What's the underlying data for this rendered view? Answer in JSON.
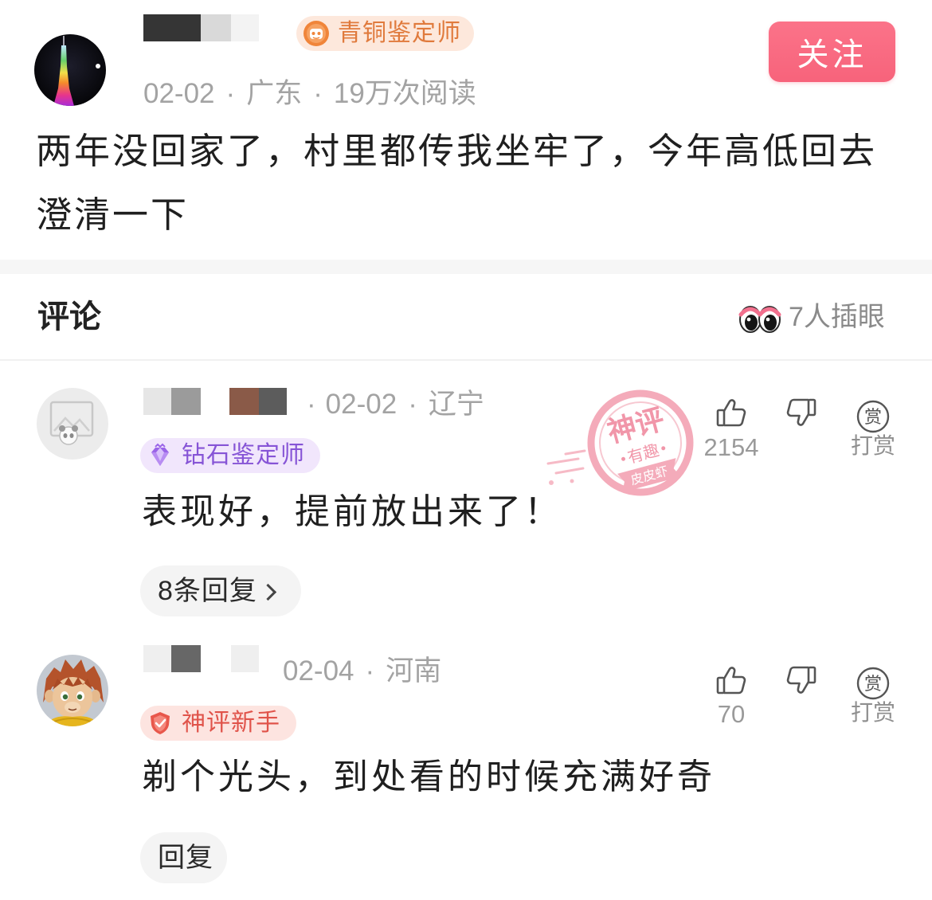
{
  "post": {
    "author": {
      "avatar_icon": "tower-night-avatar",
      "badge": {
        "label": "青铜鉴定师",
        "icon": "bronze-appraiser-icon",
        "color": "#e07a3c",
        "bg": "#fde8dc"
      }
    },
    "follow_label": "关注",
    "meta": {
      "date": "02-02",
      "separator": "·",
      "location": "广东",
      "reads": "19万次阅读"
    },
    "text_lines": [
      "两年没回家了，村里都传我坐牢了，今年高低回去",
      "澄清一下"
    ]
  },
  "comments_section": {
    "title": "评论",
    "watchers_icon": "eyes-icon",
    "watchers_label": "7人插眼"
  },
  "comments": [
    {
      "avatar_icon": "default-avatar",
      "meta": {
        "lead_separator": "·",
        "date": "02-02",
        "separator": "·",
        "location": "辽宁"
      },
      "badge": {
        "label": "钻石鉴定师",
        "icon": "diamond-appraiser-icon",
        "color": "#8654d6",
        "bg": "#f1e6fc"
      },
      "text": "表现好，提前放出来了！",
      "likes": "2154",
      "reward_icon_text": "赏",
      "reward_label": "打赏",
      "reply_label": "8条回复",
      "stamp": {
        "top": "神评",
        "middle": "有趣",
        "bottom": "皮皮虾"
      }
    },
    {
      "avatar_icon": "monkey-cartoon-avatar",
      "meta": {
        "date": "02-04",
        "separator": "·",
        "location": "河南"
      },
      "badge": {
        "label": "神评新手",
        "icon": "god-comment-novice-icon",
        "color": "#e0534a",
        "bg": "#fde4e0"
      },
      "text": "剃个光头，到处看的时候充满好奇",
      "likes": "70",
      "reward_icon_text": "赏",
      "reward_label": "打赏",
      "reply_label": "回复"
    }
  ],
  "colors": {
    "follow_bg": "#f86b80",
    "text": "#222222",
    "meta": "#a3a3a3",
    "pill_bg": "#f4f4f4",
    "stamp": "#f3a3b3"
  }
}
